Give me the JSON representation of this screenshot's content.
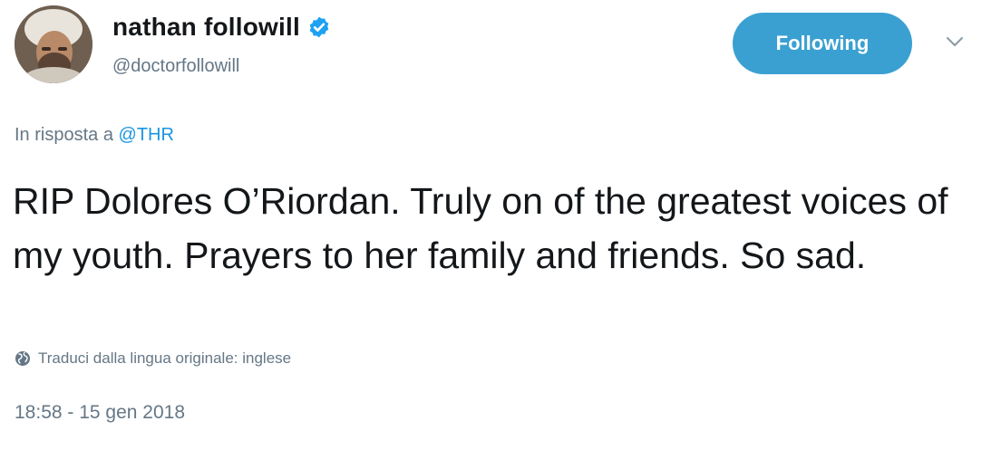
{
  "user": {
    "display_name": "nathan followill",
    "handle": "@doctorfollowill",
    "verified_icon": "verified-badge-icon",
    "avatar_icon": "avatar"
  },
  "actions": {
    "follow_label": "Following",
    "more_icon": "chevron-down-icon"
  },
  "tweet": {
    "reply_prefix": "In risposta a",
    "reply_to": "@THR",
    "text": "RIP Dolores O’Riordan. Truly on of the greatest voices of my youth. Prayers to her family and friends. So sad.",
    "translate_label": "Traduci dalla lingua originale: inglese",
    "translate_icon": "globe-icon",
    "timestamp": "18:58 - 15 gen 2018"
  },
  "colors": {
    "accent": "#3aa0d2",
    "link": "#1b95e0",
    "muted": "#657786",
    "text": "#14171a"
  }
}
